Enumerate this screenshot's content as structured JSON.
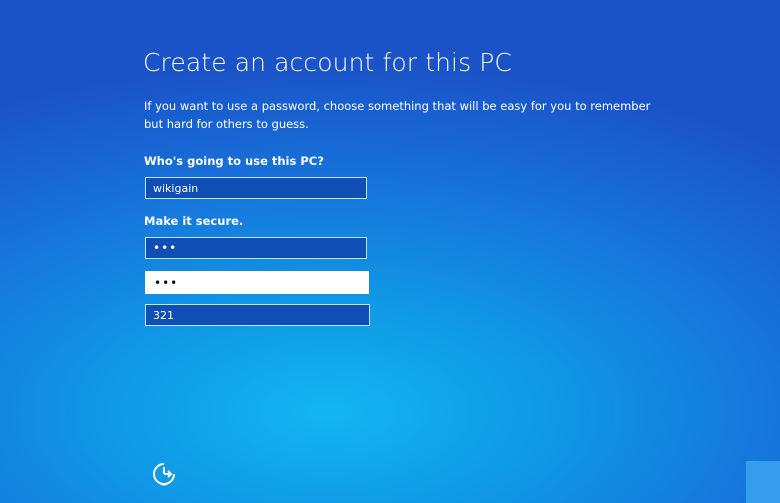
{
  "title": "Create an account for this PC",
  "instruction": "If you want to use a password, choose something that will be easy for you to remember but hard for others to guess.",
  "user_section": {
    "label": "Who's going to use this PC?",
    "username_value": "wikigain"
  },
  "secure_section": {
    "label": "Make it secure.",
    "password_value": "321",
    "confirm_value": "321",
    "hint_value": "321"
  },
  "icons": {
    "ease_of_access": "ease-of-access-icon"
  },
  "colors": {
    "background_top": "#1a52c8",
    "background_glow": "#13b6f0",
    "field_fill": "#0f4fb5",
    "field_border": "#bfe6ff",
    "focused_field": "#ffffff",
    "button_fill": "#3aa6ee"
  }
}
